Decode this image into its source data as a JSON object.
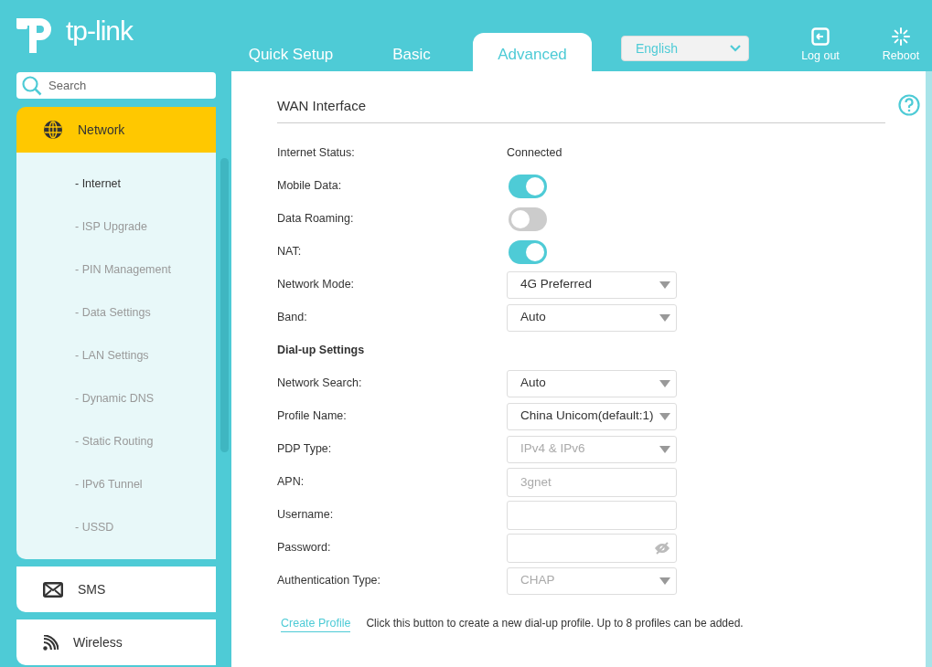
{
  "header": {
    "logo": "tp-link",
    "tabs": [
      {
        "label": "Quick Setup",
        "selected": false
      },
      {
        "label": "Basic",
        "selected": false
      },
      {
        "label": "Advanced",
        "selected": true
      }
    ],
    "language": {
      "value": "English"
    },
    "actions": [
      {
        "kind": "logout",
        "label": "Log out"
      },
      {
        "kind": "reboot",
        "label": "Reboot"
      }
    ]
  },
  "sidebar": {
    "search": {
      "placeholder": "Search"
    },
    "items": [
      {
        "kind": "globe",
        "label": "Network",
        "selected": true,
        "expanded": true,
        "children": [
          {
            "label": "- Internet",
            "selected": true
          },
          {
            "label": "- ISP Upgrade",
            "selected": false
          },
          {
            "label": "- PIN Management",
            "selected": false
          },
          {
            "label": "- Data Settings",
            "selected": false
          },
          {
            "label": "- LAN Settings",
            "selected": false
          },
          {
            "label": "- Dynamic DNS",
            "selected": false
          },
          {
            "label": "- Static Routing",
            "selected": false
          },
          {
            "label": "- IPv6 Tunnel",
            "selected": false
          },
          {
            "label": "- USSD",
            "selected": false
          }
        ]
      },
      {
        "kind": "mail",
        "label": "SMS",
        "selected": false,
        "expanded": false
      },
      {
        "kind": "wireless",
        "label": "Wireless",
        "selected": false,
        "expanded": false
      }
    ]
  },
  "content": {
    "title": "WAN Interface",
    "rows": [
      {
        "kind": "text",
        "label": "Internet Status:",
        "value": "Connected"
      },
      {
        "kind": "toggle",
        "label": "Mobile Data:",
        "on": true
      },
      {
        "kind": "toggle",
        "label": "Data Roaming:",
        "on": false
      },
      {
        "kind": "toggle",
        "label": "NAT:",
        "on": true
      },
      {
        "kind": "select",
        "label": "Network Mode:",
        "value": "4G Preferred",
        "disabled": false
      },
      {
        "kind": "select",
        "label": "Band:",
        "value": "Auto",
        "disabled": false
      },
      {
        "kind": "heading",
        "label": "Dial-up Settings"
      },
      {
        "kind": "select",
        "label": "Network Search:",
        "value": "Auto",
        "disabled": false
      },
      {
        "kind": "select",
        "label": "Profile Name:",
        "value": "China Unicom(default:1)",
        "disabled": false
      },
      {
        "kind": "select",
        "label": "PDP Type:",
        "value": "IPv4 & IPv6",
        "disabled": true
      },
      {
        "kind": "input",
        "label": "APN:",
        "value": "3gnet",
        "disabled": true
      },
      {
        "kind": "input",
        "label": "Username:"
      },
      {
        "kind": "password",
        "label": "Password:"
      },
      {
        "kind": "select",
        "label": "Authentication Type:",
        "value": "CHAP",
        "disabled": true
      }
    ],
    "create_profile": {
      "link": "Create Profile",
      "note": "Click this button to create a new dial-up profile. Up to 8 profiles can be added."
    }
  }
}
